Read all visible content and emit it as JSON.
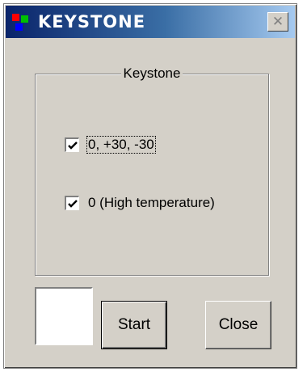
{
  "window": {
    "title": "KEYSTONE",
    "close_glyph": "✕",
    "icon": "app-icon",
    "icon_colors": [
      "#ff0000",
      "#00c000",
      "#0000ff"
    ]
  },
  "keystone_group": {
    "label": "Keystone",
    "options": [
      {
        "label": "0, +30, -30",
        "checked": true
      },
      {
        "label": "0 (High temperature)",
        "checked": true
      }
    ]
  },
  "buttons": {
    "start_label": "Start",
    "close_label": "Close"
  },
  "colors": {
    "face": "#d4d0c8",
    "title_start": "#0a246a",
    "title_end": "#a6caf0"
  }
}
